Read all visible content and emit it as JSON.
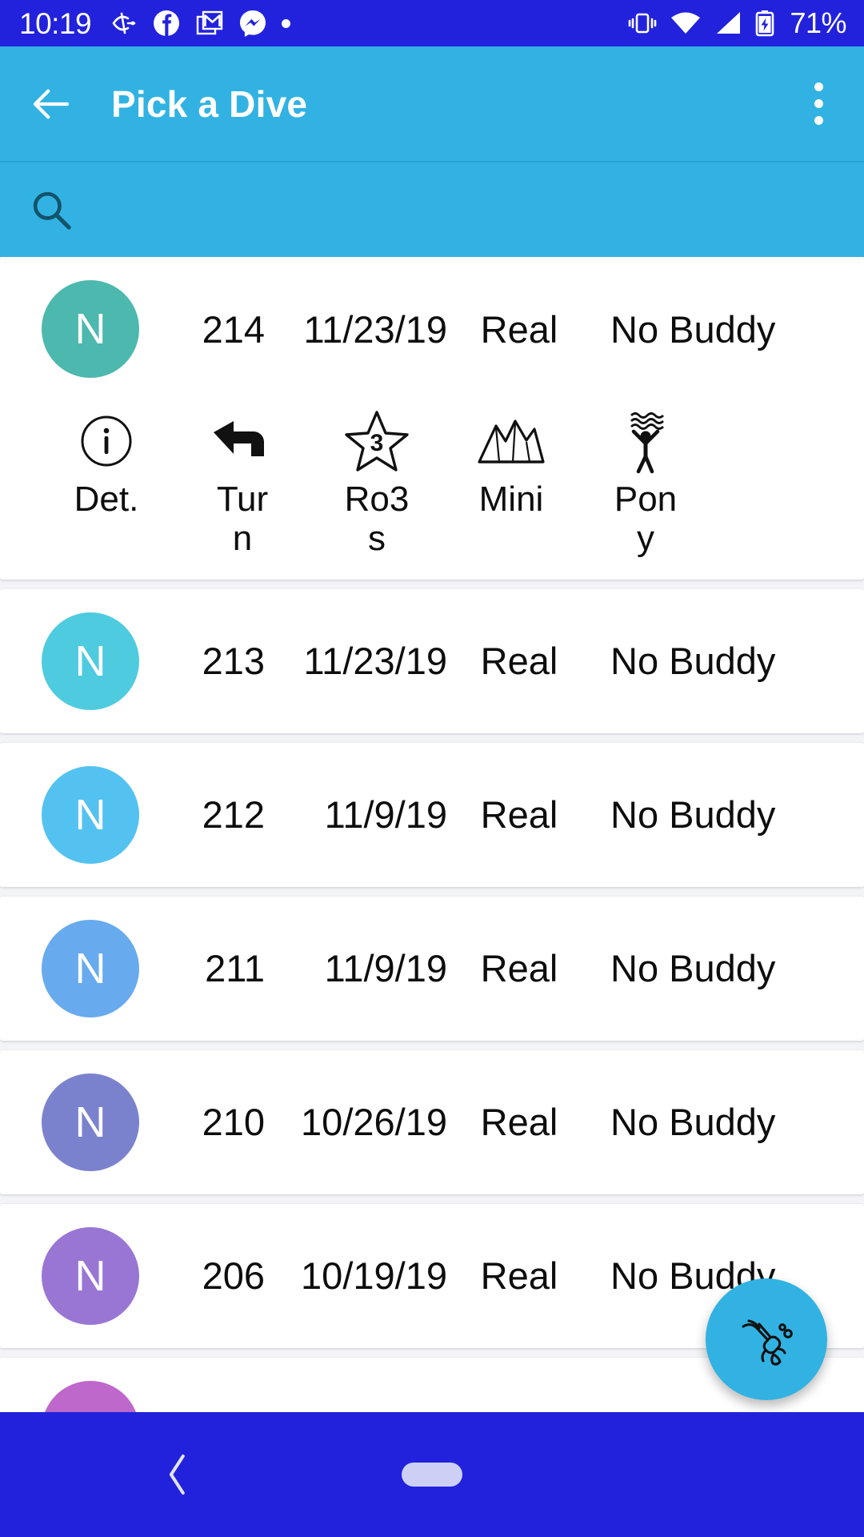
{
  "status_bar": {
    "time": "10:19",
    "battery_percent": "71%",
    "left_icons": [
      "tasker-icon",
      "facebook-icon",
      "gmail-icon",
      "messenger-icon",
      "dot-icon"
    ],
    "right_icons": [
      "vibrate-icon",
      "wifi-icon",
      "cell-signal-icon",
      "battery-charging-icon"
    ],
    "background_color": "#2222dd"
  },
  "app_bar": {
    "title": "Pick a Dive",
    "back_icon": "back-arrow-icon",
    "overflow_icon": "overflow-menu-icon",
    "background_color": "#31b2e3"
  },
  "search": {
    "icon": "search-icon",
    "value": "",
    "placeholder": ""
  },
  "list": {
    "items": [
      {
        "avatar_letter": "N",
        "avatar_color": "#4db8ae",
        "number": "214",
        "date": "11/23/19",
        "type": "Real",
        "buddy": "No Buddy",
        "expanded": true,
        "actions": [
          {
            "label": "Det.",
            "icon": "info-circle-icon"
          },
          {
            "label": "Turn",
            "icon": "undo-arrow-icon"
          },
          {
            "label": "Ro3s",
            "icon": "star-3-icon",
            "badge": "3"
          },
          {
            "label": "Mini",
            "icon": "mountains-icon"
          },
          {
            "label": "Pony",
            "icon": "diver-waves-icon"
          }
        ]
      },
      {
        "avatar_letter": "N",
        "avatar_color": "#4fcbe0",
        "number": "213",
        "date": "11/23/19",
        "type": "Real",
        "buddy": "No Buddy",
        "expanded": false
      },
      {
        "avatar_letter": "N",
        "avatar_color": "#54c2f0",
        "number": "212",
        "date": "11/9/19",
        "type": "Real",
        "buddy": "No Buddy",
        "expanded": false
      },
      {
        "avatar_letter": "N",
        "avatar_color": "#68aaee",
        "number": "211",
        "date": "11/9/19",
        "type": "Real",
        "buddy": "No Buddy",
        "expanded": false
      },
      {
        "avatar_letter": "N",
        "avatar_color": "#7b82cd",
        "number": "210",
        "date": "10/26/19",
        "type": "Real",
        "buddy": "No Buddy",
        "expanded": false
      },
      {
        "avatar_letter": "N",
        "avatar_color": "#9a76d4",
        "number": "206",
        "date": "10/19/19",
        "type": "Real",
        "buddy": "No Buddy",
        "expanded": false
      },
      {
        "avatar_letter": "N",
        "avatar_color": "#bd68ca",
        "number": "",
        "date": "",
        "type": "",
        "buddy": "",
        "expanded": false
      }
    ]
  },
  "fab": {
    "icon": "scuba-diver-icon",
    "color": "#31b2e3"
  },
  "nav_bar": {
    "back_icon": "nav-back-icon",
    "home_pill_icon": "home-pill-icon",
    "background_color": "#2222dd"
  }
}
